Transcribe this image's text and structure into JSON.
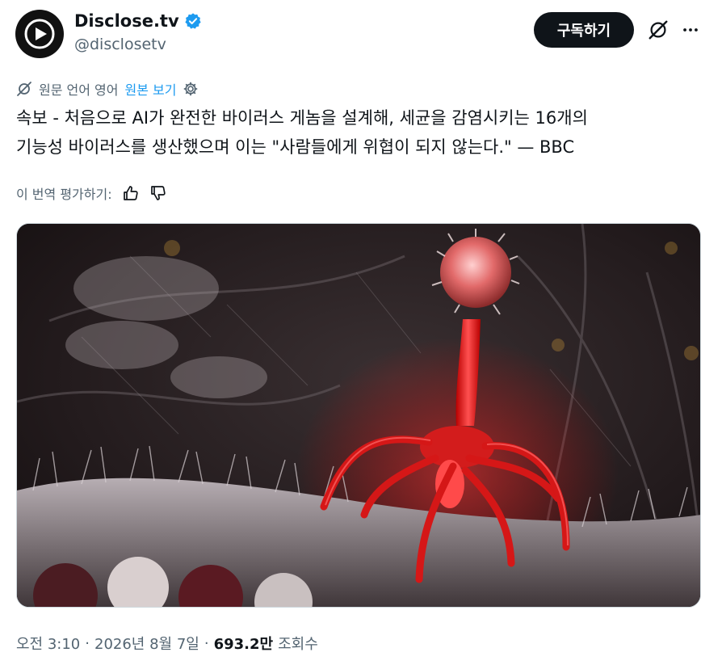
{
  "account": {
    "display_name": "Disclose.tv",
    "handle": "@disclosetv",
    "avatar_icon": "play-logo-icon",
    "verified_icon": "verified-badge-icon",
    "verified_color": "#1d9bf0"
  },
  "actions": {
    "subscribe_label": "구독하기",
    "grok_icon": "grok-icon",
    "more_icon": "more-icon"
  },
  "translation": {
    "source_label": "원문 언어 영어",
    "show_original_label": "원본 보기",
    "translate_icon": "translate-off-icon",
    "settings_icon": "gear-icon",
    "link_color": "#1d9bf0"
  },
  "tweet": {
    "text": "속보 - 처음으로 AI가 완전한 바이러스 게놈을 설계해, 세균을 감염시키는 16개의\n기능성 바이러스를 생산했으며 이는 \"사람들에게 위협이 되지 않는다.\" — BBC"
  },
  "rating": {
    "label": "이 번역 평가하기:",
    "thumbs_up_icon": "thumbs-up-icon",
    "thumbs_down_icon": "thumbs-down-icon"
  },
  "media": {
    "image_icon": "bacteriophage-image"
  },
  "meta": {
    "time": "오전 3:10",
    "separator1": "·",
    "date": "2026년 8월 7일",
    "separator2": "·",
    "views_count": "693.2만",
    "views_label": "조회수"
  }
}
